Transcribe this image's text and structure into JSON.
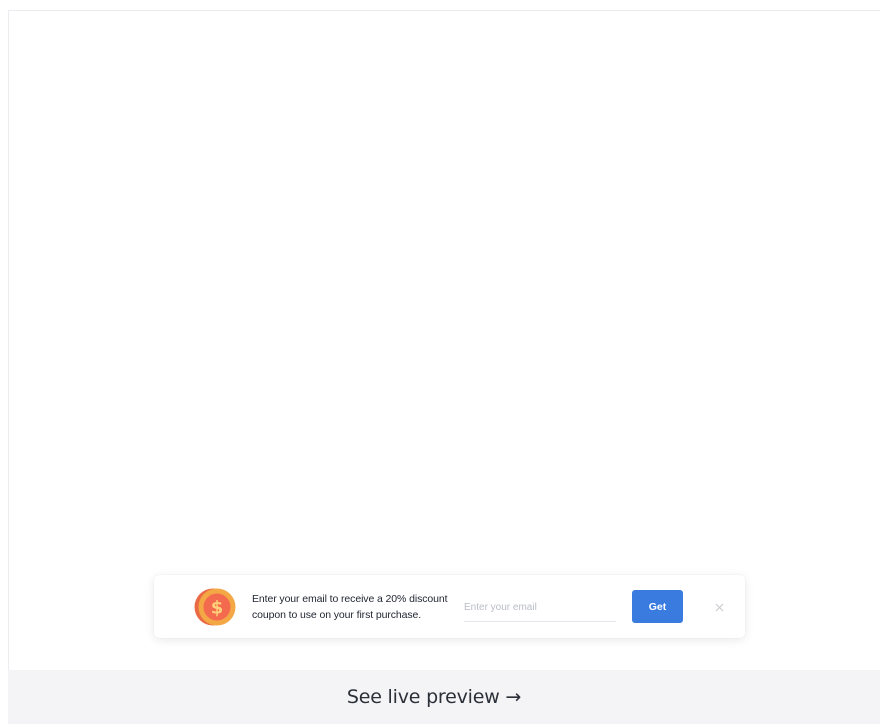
{
  "popup": {
    "coin_icon": "dollar-coin-icon",
    "coin_symbol": "$",
    "message": "Enter your email to receive a 20% discount coupon to use on your first purchase.",
    "email_placeholder": "Enter your email",
    "email_value": "",
    "get_label": "Get",
    "close_icon": "close-icon",
    "colors": {
      "accent": "#3a7be0",
      "coin_outer": "#f0a443",
      "coin_inner": "#f46b4c",
      "coin_shadow": "#e7553f"
    }
  },
  "footer": {
    "preview_label": "See live preview →"
  }
}
